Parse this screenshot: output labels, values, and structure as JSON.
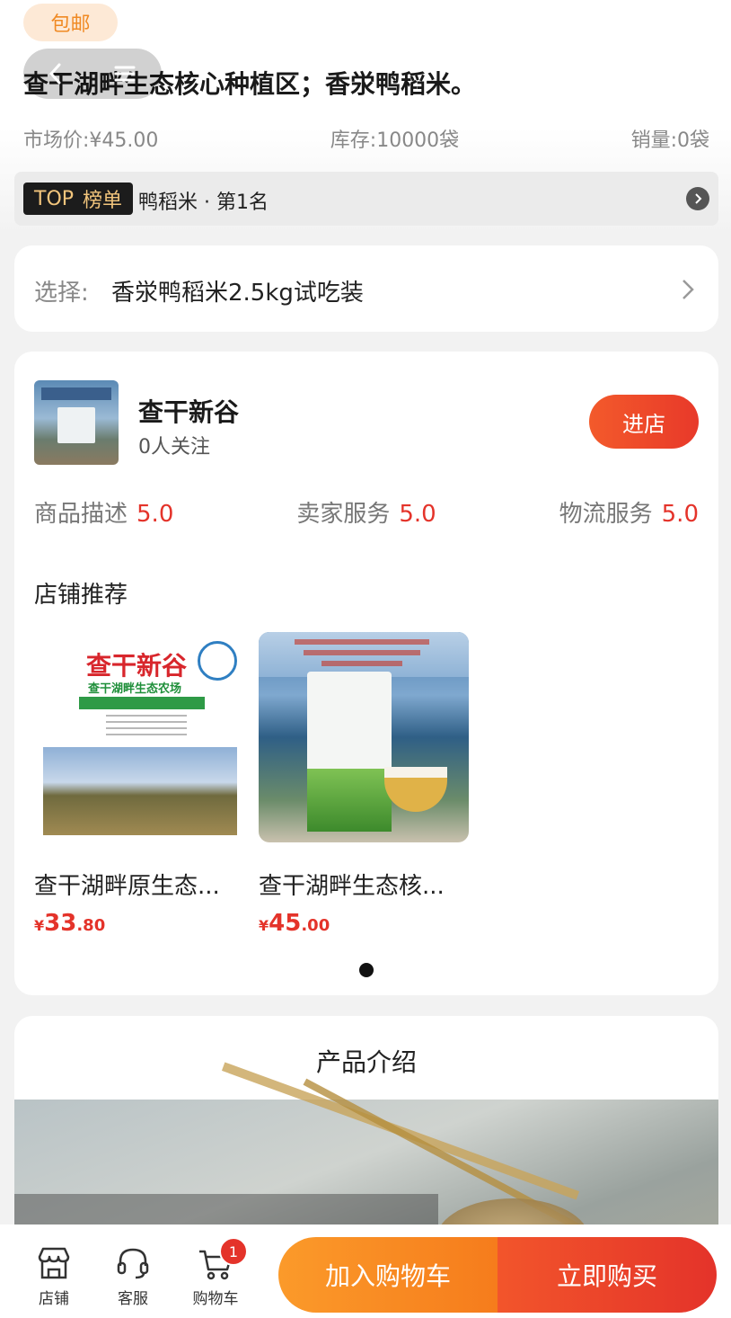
{
  "header": {
    "badge_label": "包邮",
    "title": "查干湖畔生态核心种植区；香泶鸭稻米。",
    "market_price": "市场价:¥45.00",
    "stock": "库存:10000袋",
    "sales": "销量:0袋"
  },
  "top_rank": {
    "tag_top": "TOP",
    "tag_label": "榜单",
    "text": "鸭稻米 · 第1名"
  },
  "selection": {
    "label": "选择:",
    "value": "香泶鸭稻米2.5kg试吃装"
  },
  "shop": {
    "name": "查干新谷",
    "followers": "0人关注",
    "enter_label": "进店",
    "ratings": [
      {
        "label": "商品描述",
        "value": "5.0"
      },
      {
        "label": "卖家服务",
        "value": "5.0"
      },
      {
        "label": "物流服务",
        "value": "5.0"
      }
    ],
    "recommend_title": "店铺推荐",
    "recommendations": [
      {
        "name": "查干湖畔原生态...",
        "price_currency": "¥",
        "price_int": "33",
        "price_dec": ".80",
        "image_text": "查干新谷",
        "image_subtext": "查干湖畔生态农场"
      },
      {
        "name": "查干湖畔生态核...",
        "price_currency": "¥",
        "price_int": "45",
        "price_dec": ".00"
      }
    ]
  },
  "intro": {
    "title": "产品介绍"
  },
  "bottom_nav": {
    "items": [
      {
        "label": "店铺",
        "icon": "store-icon"
      },
      {
        "label": "客服",
        "icon": "headset-icon"
      },
      {
        "label": "购物车",
        "icon": "cart-icon",
        "badge": "1"
      }
    ],
    "add_to_cart": "加入购物车",
    "buy_now": "立即购买"
  },
  "colors": {
    "accent_red": "#e4332a",
    "accent_orange": "#f67c1c",
    "badge_bg": "#fde9d6"
  }
}
